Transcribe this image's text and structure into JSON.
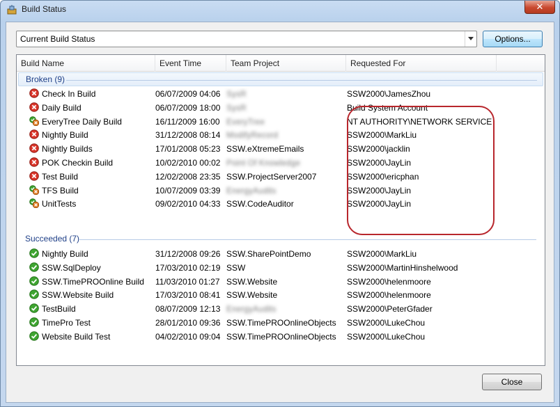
{
  "window": {
    "title": "Build Status",
    "app_icon": "build-status-icon"
  },
  "toolbar": {
    "view_select_value": "Current Build Status",
    "options_label": "Options..."
  },
  "columns": [
    "Build Name",
    "Event Time",
    "Team Project",
    "Requested For"
  ],
  "groups": [
    {
      "label": "Broken (9)",
      "rows": [
        {
          "status": "failed-icon",
          "name": "Check In Build",
          "time": "06/07/2009 04:06",
          "project": "SysR",
          "project_blurred": true,
          "requested_for": "SSW2000\\JamesZhou"
        },
        {
          "status": "failed-icon",
          "name": "Daily Build",
          "time": "06/07/2009 18:00",
          "project": "SysR",
          "project_blurred": true,
          "requested_for": "Build System Account"
        },
        {
          "status": "partial-icon",
          "name": "EveryTree Daily Build",
          "time": "16/11/2009 16:00",
          "project": "EveryTree",
          "project_blurred": true,
          "requested_for": "NT AUTHORITY\\NETWORK SERVICE"
        },
        {
          "status": "failed-icon",
          "name": "Nightly Build",
          "time": "31/12/2008 08:14",
          "project": "ModifyRecord",
          "project_blurred": true,
          "requested_for": "SSW2000\\MarkLiu"
        },
        {
          "status": "failed-icon",
          "name": "Nightly Builds",
          "time": "17/01/2008 05:23",
          "project": "SSW.eXtremeEmails",
          "project_blurred": false,
          "requested_for": "SSW2000\\jacklin"
        },
        {
          "status": "failed-icon",
          "name": "POK Checkin Build",
          "time": "10/02/2010 00:02",
          "project": "Point Of Knowledge",
          "project_blurred": true,
          "requested_for": "SSW2000\\JayLin"
        },
        {
          "status": "failed-icon",
          "name": "Test Build",
          "time": "12/02/2008 23:35",
          "project": "SSW.ProjectServer2007",
          "project_blurred": false,
          "requested_for": "SSW2000\\ericphan"
        },
        {
          "status": "partial-icon",
          "name": "TFS Build",
          "time": "10/07/2009 03:39",
          "project": "EnergyAudits",
          "project_blurred": true,
          "requested_for": "SSW2000\\JayLin"
        },
        {
          "status": "partial-icon",
          "name": "UnitTests",
          "time": "09/02/2010 04:33",
          "project": "SSW.CodeAuditor",
          "project_blurred": false,
          "requested_for": "SSW2000\\JayLin"
        }
      ]
    },
    {
      "label": "Succeeded (7)",
      "rows": [
        {
          "status": "succeeded-icon",
          "name": "Nightly Build",
          "time": "31/12/2008 09:26",
          "project": "SSW.SharePointDemo",
          "project_blurred": false,
          "requested_for": "SSW2000\\MarkLiu"
        },
        {
          "status": "succeeded-icon",
          "name": "SSW.SqlDeploy",
          "time": "17/03/2010 02:19",
          "project": "SSW",
          "project_blurred": false,
          "requested_for": "SSW2000\\MartinHinshelwood"
        },
        {
          "status": "succeeded-icon",
          "name": "SSW.TimePROOnline Build",
          "time": "11/03/2010 01:27",
          "project": "SSW.Website",
          "project_blurred": false,
          "requested_for": "SSW2000\\helenmoore"
        },
        {
          "status": "succeeded-icon",
          "name": "SSW.Website Build",
          "time": "17/03/2010 08:41",
          "project": "SSW.Website",
          "project_blurred": false,
          "requested_for": "SSW2000\\helenmoore"
        },
        {
          "status": "succeeded-icon",
          "name": "TestBuild",
          "time": "08/07/2009 12:13",
          "project": "EnergyAudits",
          "project_blurred": true,
          "requested_for": "SSW2000\\PeterGfader"
        },
        {
          "status": "succeeded-icon",
          "name": "TimePro Test",
          "time": "28/01/2010 09:36",
          "project": "SSW.TimePROOnlineObjects",
          "project_blurred": false,
          "requested_for": "SSW2000\\LukeChou"
        },
        {
          "status": "succeeded-icon",
          "name": "Website Build Test",
          "time": "04/02/2010 09:04",
          "project": "SSW.TimePROOnlineObjects",
          "project_blurred": false,
          "requested_for": "SSW2000\\LukeChou"
        }
      ]
    }
  ],
  "footer": {
    "close_label": "Close"
  },
  "colors": {
    "failed": "#d9352a",
    "succeeded": "#3fa531",
    "partial_overlay": "#e07b1f",
    "group_text": "#1e3f87",
    "annotation": "#b8262c"
  }
}
